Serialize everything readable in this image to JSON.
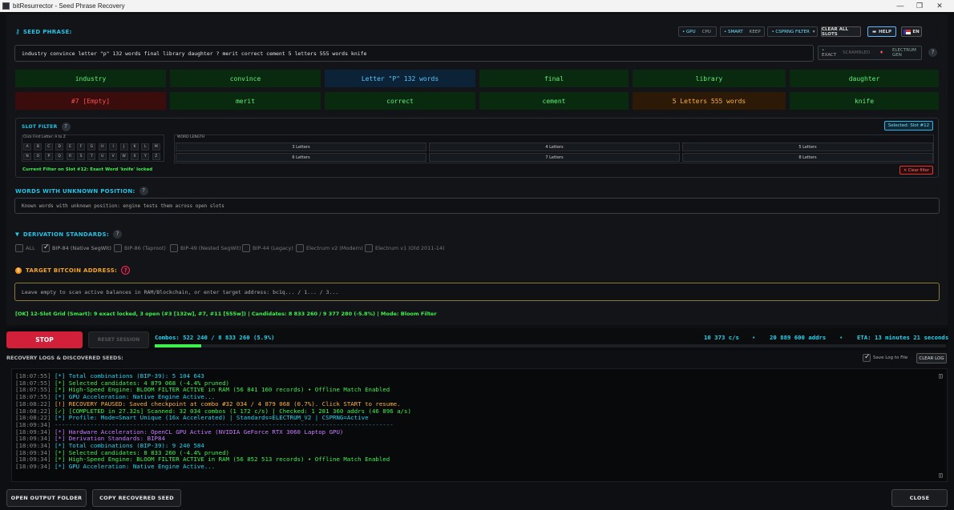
{
  "window": {
    "title": "bitResurrector - Seed Phrase Recovery"
  },
  "seed": {
    "label": "SEED PHRASE:",
    "hint": "?",
    "value": "industry convince letter \"p\" 132 words final library daughter ? merit correct cement 5 letters 555 words knife",
    "mode_exact": "• EXACT",
    "mode_scrambled": "SCRAMBLED",
    "mode_electrum": "ELECTRUM GEN",
    "help_icon": "?"
  },
  "toolbar": {
    "gpu": "• GPU",
    "cpu": "CPU",
    "smart": "• SMART",
    "keep": "KEEP",
    "csprng": "• CSPRNG FILTER",
    "clear_slots": "CLEAR ALL SLOTS",
    "help": "HELP",
    "lang": "EN"
  },
  "slots": {
    "row1": [
      "industry",
      "convince",
      "Letter \"P\" 132 words",
      "final",
      "library",
      "daughter"
    ],
    "row2": [
      "#7 [Empty]",
      "merit",
      "correct",
      "cement",
      "5 Letters 555 words",
      "knife"
    ]
  },
  "filter": {
    "label": "SLOT FILTER",
    "hint": "?",
    "selected": "Selected: Slot #12",
    "letters_title": "Click First Letter: A to Z",
    "keys": [
      "A",
      "B",
      "C",
      "D",
      "E",
      "F",
      "G",
      "H",
      "I",
      "J",
      "K",
      "L",
      "M",
      "N",
      "O",
      "P",
      "Q",
      "R",
      "S",
      "T",
      "U",
      "V",
      "W",
      "X",
      "Y",
      "Z"
    ],
    "word_length_title": "WORD LENGTH",
    "lengths": [
      "3 Letters",
      "4 Letters",
      "5 Letters",
      "6 Letters",
      "7 Letters",
      "8 Letters"
    ],
    "current": "Current Filter on Slot #12: Exact Word 'knife' locked",
    "clear": "✕ Clear filter"
  },
  "unknown": {
    "label": "WORDS WITH UNKNOWN POSITION:",
    "hint": "?",
    "placeholder": "Known words with unknown position: engine tests them across open slots"
  },
  "derivation": {
    "label": "DERIVATION STANDARDS:",
    "hint": "?",
    "options": [
      "ALL",
      "BIP-84 (Native SegWit)",
      "BIP-86 (Taproot)",
      "BIP-49 (Nested SegWit)",
      "BIP-44 (Legacy)",
      "Electrum v2 (Modern)",
      "Electrum v1 (Old 2011-14)"
    ]
  },
  "target": {
    "label": "TARGET BITCOIN ADDRESS:",
    "hint": "?",
    "placeholder": "Leave empty to scan active balances in RAM/Blockchain, or enter target address: bc1q... / 1... / 3..."
  },
  "status_line": "[OK] 12-Slot Grid (Smart): 9 exact locked, 3 open (#3 [132w], #7, #11 [555w]) | Candidates: 8 833 260 / 9 377 280 (-5.8%) | Mode: Bloom Filter",
  "controls": {
    "stop": "STOP",
    "reset": "RESET SESSION",
    "combos": "Combos: 522 240 / 8 833 260 (5.9%)",
    "progress": 0.059,
    "speed": "10 373 c/s",
    "addrs": "20 889 600 addrs",
    "eta": "ETA: 13 minutes 21 seconds",
    "dot": "•"
  },
  "logs": {
    "title": "RECOVERY LOGS & DISCOVERED SEEDS:",
    "save_label": "Save Log to File",
    "clear": "CLEAR LOG",
    "lines": [
      {
        "ts": "[18:07:55]",
        "text": "[*] Total combinations (BIP-39): 5 104 643",
        "c": "c-cyan"
      },
      {
        "ts": "[18:07:55]",
        "text": "[*] Selected candidates: 4 879 068 (-4.4% pruned)",
        "c": "c-green"
      },
      {
        "ts": "[18:07:55]",
        "text": "[*] High-Speed Engine: BLOOM FILTER ACTIVE in RAM (56 841 160 records) • Offline Match Enabled",
        "c": "c-green"
      },
      {
        "ts": "[18:07:55]",
        "text": "[*] GPU Acceleration: Native Engine Active...",
        "c": "c-cyan"
      },
      {
        "ts": "[18:08:22]",
        "text": "[!] RECOVERY PAUSED: Saved checkpoint at combo #32 034 / 4 879 068 (0.7%). Click START to resume.",
        "c": "c-orange"
      },
      {
        "ts": "[18:08:22]",
        "text": "[✓] [COMPLETED in 27.32s] Scanned: 32 034 combos (1 172 c/s) | Checked: 1 281 360 addrs (46 896 a/s)",
        "c": "c-green"
      },
      {
        "ts": "[18:08:22]",
        "text": "[*] Profile: Mode=Smart Unique (16x Accelerated) | Standards=ELECTRUM_V2 | CSPRNG=Active",
        "c": "c-cyan"
      },
      {
        "ts": "[18:09:34]",
        "text": "-----------------------------------------------------------------------------------------------",
        "c": "c-sep"
      },
      {
        "ts": "[18:09:34]",
        "text": "[*] Hardware Acceleration: OpenCL GPU Active (NVIDIA GeForce RTX 3060 Laptop GPU)",
        "c": "c-purple"
      },
      {
        "ts": "[18:09:34]",
        "text": "[*] Derivation Standards: BIP84",
        "c": "c-purple"
      },
      {
        "ts": "[18:09:34]",
        "text": "[*] Total combinations (BIP-39): 9 240 584",
        "c": "c-cyan"
      },
      {
        "ts": "[18:09:34]",
        "text": "[*] Selected candidates: 8 833 260 (-4.4% pruned)",
        "c": "c-green"
      },
      {
        "ts": "[18:09:34]",
        "text": "[*] High-Speed Engine: BLOOM FILTER ACTIVE in RAM (56 852 513 records) • Offline Match Enabled",
        "c": "c-green"
      },
      {
        "ts": "[18:09:34]",
        "text": "[*] GPU Acceleration: Native Engine Active...",
        "c": "c-cyan"
      }
    ]
  },
  "footer": {
    "open_folder": "OPEN OUTPUT FOLDER",
    "copy_seed": "COPY RECOVERED SEED",
    "close": "CLOSE"
  }
}
